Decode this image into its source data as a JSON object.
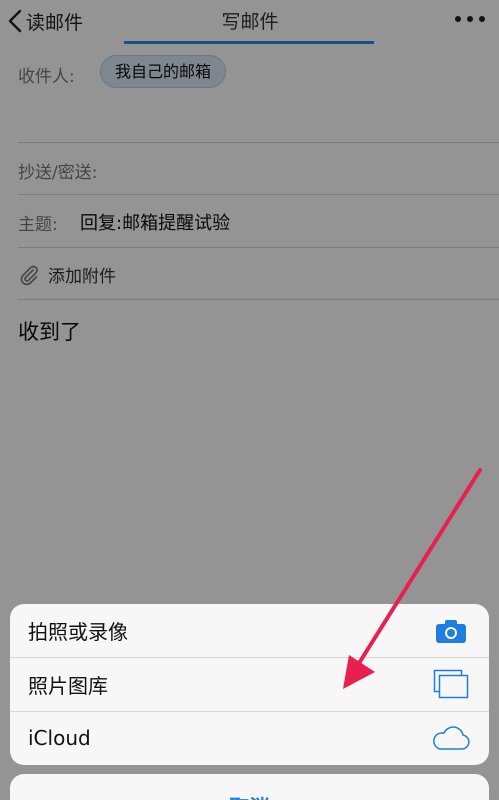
{
  "nav": {
    "back_label": "读邮件",
    "title": "写邮件"
  },
  "compose": {
    "to_label": "收件人:",
    "recipient_chip": "我自己的邮箱",
    "cc_label": "抄送/密送:",
    "subject_label": "主题:",
    "subject_value": "回复:邮箱提醒试验",
    "attach_label": "添加附件",
    "body": "收到了"
  },
  "action_sheet": {
    "items": [
      {
        "label": "拍照或录像",
        "icon": "camera-icon"
      },
      {
        "label": "照片图库",
        "icon": "photo-library-icon"
      },
      {
        "label": "iCloud",
        "icon": "cloud-icon"
      }
    ],
    "cancel_label": "取消"
  },
  "colors": {
    "accent": "#1f7ee0",
    "underline": "#2b8ae6",
    "annotation_arrow": "#e8204f",
    "chip_bg": "#d9e7f4"
  }
}
